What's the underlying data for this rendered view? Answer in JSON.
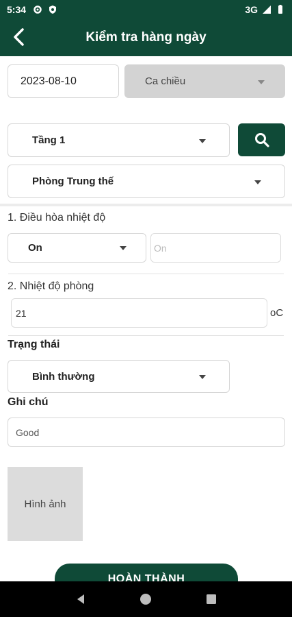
{
  "status_bar": {
    "time": "5:34",
    "network": "3G"
  },
  "app_bar": {
    "title": "Kiểm tra hàng ngày"
  },
  "filters": {
    "date": "2023-08-10",
    "shift": "Ca chiều",
    "floor": "Tầng 1",
    "room": "Phòng Trung thế"
  },
  "section1": {
    "title": "1. Điều hòa nhiệt độ",
    "select_value": "On",
    "input_placeholder": "On"
  },
  "section2": {
    "title": "2. Nhiệt độ phòng",
    "value": "21",
    "unit": "oC"
  },
  "status": {
    "label": "Trạng thái",
    "value": "Bình thường"
  },
  "note": {
    "label": "Ghi chú",
    "value": "Good"
  },
  "image": {
    "label": "Hình ảnh"
  },
  "actions": {
    "complete_label": "HOÀN THÀNH"
  },
  "colors": {
    "primary": "#0f4a37"
  }
}
